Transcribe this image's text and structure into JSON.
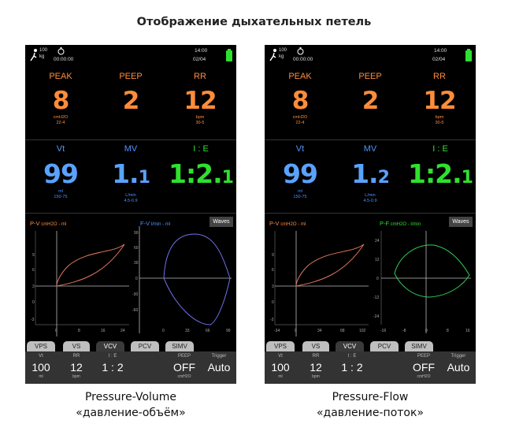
{
  "heading": "Отображение дыхательных петель",
  "colors": {
    "orange": "#ff8c3a",
    "blue": "#4e93ff",
    "green": "#30e030",
    "loop_pink": "#e07860",
    "loop_violet": "#6f6fe8",
    "loop_green": "#2fcc55"
  },
  "screens": [
    {
      "status": {
        "patient_top": "100",
        "patient_bottom": "kg",
        "timer": "00:00:00",
        "time": "14:00",
        "date": "02/04"
      },
      "params_row1": [
        {
          "label": "PEAK",
          "value": "8",
          "unit": "cmH2O",
          "range": "22-4"
        },
        {
          "label": "PEEP",
          "value": "2",
          "unit": "",
          "range": ""
        },
        {
          "label": "RR",
          "value": "12",
          "unit": "bpm",
          "range": "30-5"
        }
      ],
      "params_row2": [
        {
          "label": "Vt",
          "value": "99",
          "unit": "ml",
          "range": "150-75"
        },
        {
          "label": "MV",
          "value_int": "1.",
          "value_dec": "1",
          "unit": "L/min",
          "range": "4.5-0.9"
        },
        {
          "label": "I : E",
          "value_int": "1:2.",
          "value_dec": "1"
        }
      ],
      "loop1": {
        "title": "P-V",
        "units": "cmH2O - ml",
        "x_ticks": [
          "0",
          "8",
          "16",
          "24"
        ],
        "y_ticks": [
          "9",
          "6",
          "3",
          "0",
          "-3"
        ]
      },
      "loop2": {
        "title": "F-V",
        "units": "l/min - ml",
        "x_ticks": [
          "0",
          "33",
          "66",
          "99"
        ],
        "y_ticks": [
          "90",
          "60",
          "30",
          "0",
          "-30",
          "-60"
        ]
      },
      "waves_label": "Waves",
      "tabs": [
        "VPS",
        "VS",
        "VCV",
        "PCV",
        "SIMV"
      ],
      "active_tab": "VCV",
      "bottom": [
        {
          "label": "Vt",
          "value": "100",
          "unit": "ml"
        },
        {
          "label": "RR",
          "value": "12",
          "unit": "bpm"
        },
        {
          "label": "I : E",
          "value": "1 : 2",
          "unit": ""
        },
        {
          "label": "PEEP",
          "value": "OFF",
          "unit": "cmH2O"
        },
        {
          "label": "Trigger",
          "value": "Auto",
          "unit": ""
        }
      ],
      "caption_line1": "Pressure-Volume",
      "caption_line2": "«давление-объём»"
    },
    {
      "status": {
        "patient_top": "100",
        "patient_bottom": "kg",
        "timer": "00:00:00",
        "time": "14:00",
        "date": "02/04"
      },
      "params_row1": [
        {
          "label": "PEAK",
          "value": "8",
          "unit": "cmH2O",
          "range": "22-4"
        },
        {
          "label": "PEEP",
          "value": "2",
          "unit": "",
          "range": ""
        },
        {
          "label": "RR",
          "value": "12",
          "unit": "bpm",
          "range": "30-5"
        }
      ],
      "params_row2": [
        {
          "label": "Vt",
          "value": "99",
          "unit": "ml",
          "range": "150-75"
        },
        {
          "label": "MV",
          "value_int": "1.",
          "value_dec": "2",
          "unit": "L/min",
          "range": "4.5-0.9"
        },
        {
          "label": "I : E",
          "value_int": "1:2.",
          "value_dec": "1"
        }
      ],
      "loop1": {
        "title": "P-V",
        "units": "cmH2O - ml",
        "x_ticks": [
          "-34",
          "0",
          "34",
          "68",
          "102"
        ],
        "y_ticks": [
          "9",
          "6",
          "3",
          "0",
          "-3"
        ]
      },
      "loop2": {
        "title": "P-F",
        "units": "cmH2O - l/min",
        "x_ticks": [
          "-16",
          "-8",
          "0",
          "8",
          "16"
        ],
        "y_ticks": [
          "24",
          "12",
          "0",
          "-12",
          "-24"
        ]
      },
      "waves_label": "Waves",
      "tabs": [
        "VPS",
        "VS",
        "VCV",
        "PCV",
        "SIMV"
      ],
      "active_tab": "VCV",
      "bottom": [
        {
          "label": "Vt",
          "value": "100",
          "unit": "ml"
        },
        {
          "label": "RR",
          "value": "12",
          "unit": "bpm"
        },
        {
          "label": "I : E",
          "value": "1 : 2",
          "unit": ""
        },
        {
          "label": "PEEP",
          "value": "OFF",
          "unit": "cmH2O"
        },
        {
          "label": "Trigger",
          "value": "Auto",
          "unit": ""
        }
      ],
      "caption_line1": "Pressure-Flow",
      "caption_line2": "«давление-поток»"
    }
  ]
}
